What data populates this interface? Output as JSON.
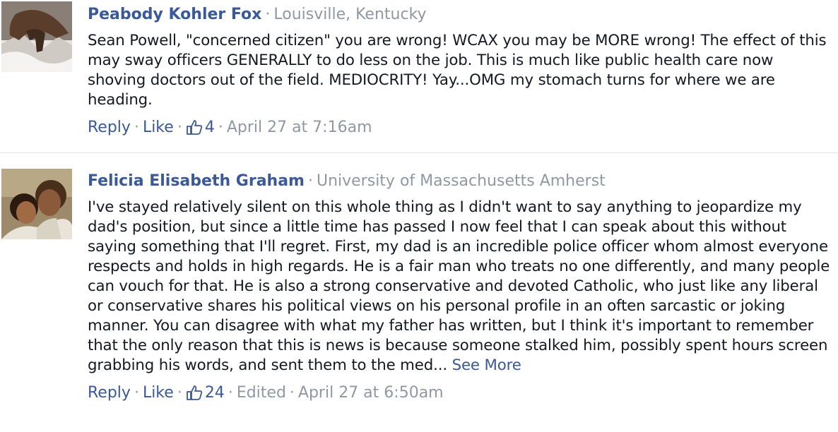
{
  "comments": [
    {
      "author": "Peabody Kohler Fox",
      "affiliation": "Louisville, Kentucky",
      "text": "Sean Powell, \"concerned citizen\" you are wrong! WCAX you may be MORE wrong! The effect of this may sway officers GENERALLY to do less on the job. This is much like public health care now shoving doctors out of the field. MEDIOCRITY! Yay...OMG my stomach turns for where we are heading.",
      "reply": "Reply",
      "like": "Like",
      "like_count": "4",
      "timestamp": "April 27 at 7:16am",
      "separator": "·"
    },
    {
      "author": "Felicia Elisabeth Graham",
      "affiliation": "University of Massachusetts Amherst",
      "text": "I've stayed relatively silent on this whole thing as I didn't want to say anything to jeopardize my dad's position, but since a little time has passed I now feel that I can speak about this without saying something that I'll regret. First, my dad is an incredible police officer whom almost everyone respects and holds in high regards. He is a fair man who treats no one differently, and many people can vouch for that. He is also a strong conservative and devoted Catholic, who just like any liberal or conservative shares his political views on his personal profile in an often sarcastic or joking manner. You can disagree with what my father has written, but I think it's important to remember that the only reason that this is news is because someone stalked him, possibly spent hours screen grabbing his words, and sent them to the med...",
      "see_more": "See More",
      "reply": "Reply",
      "like": "Like",
      "like_count": "24",
      "edited": "Edited",
      "timestamp": "April 27 at 6:50am",
      "separator": "·"
    }
  ],
  "colors": {
    "link": "#3b5998",
    "meta": "#9197a3",
    "text": "#141823",
    "divider": "#e1e2e5"
  },
  "icons": {
    "like": "thumbs-up-icon"
  }
}
